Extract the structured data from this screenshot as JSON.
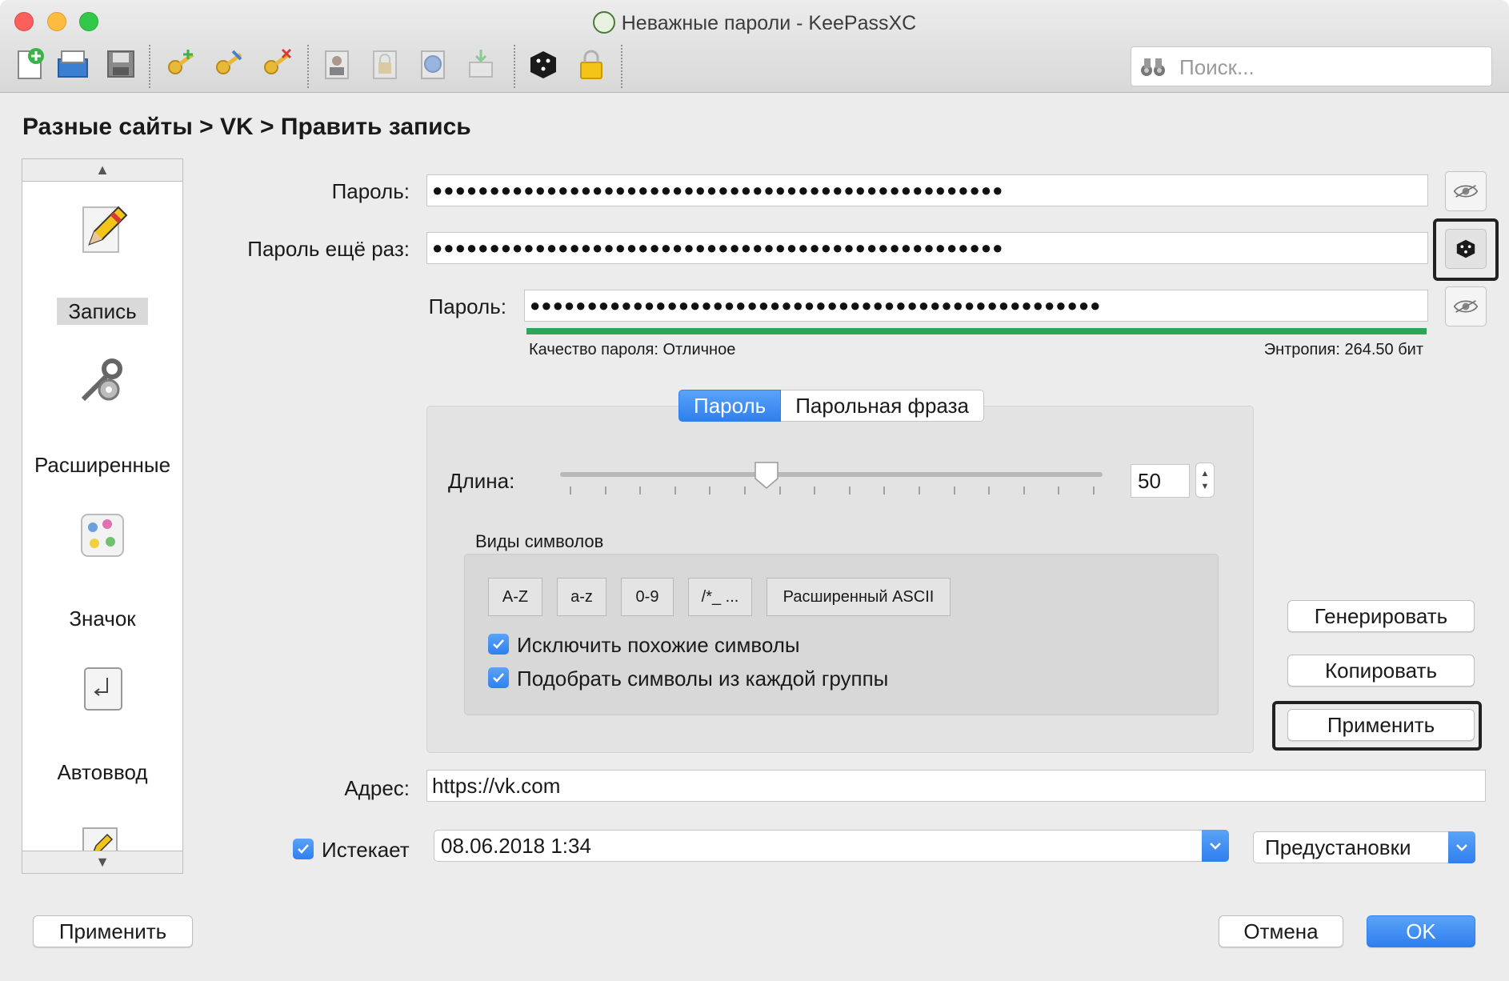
{
  "window": {
    "title": "Неважные пароли - KeePassXC"
  },
  "toolbar": {
    "items": [
      "new-database-icon",
      "open-database-icon",
      "save-database-icon",
      "add-entry-icon",
      "edit-entry-icon",
      "delete-entry-icon",
      "copy-username-icon",
      "copy-password-icon",
      "open-url-icon",
      "autotype-icon",
      "password-generator-icon",
      "lock-database-icon"
    ]
  },
  "search": {
    "placeholder": "Поиск..."
  },
  "breadcrumb": "Разные сайты > VK > Править запись",
  "sidebar": {
    "items": [
      {
        "label": "Запись",
        "icon": "pencil-icon",
        "selected": true
      },
      {
        "label": "Расширенные",
        "icon": "tools-icon",
        "selected": false
      },
      {
        "label": "Значок",
        "icon": "palette-icon",
        "selected": false
      },
      {
        "label": "Автоввод",
        "icon": "return-key-icon",
        "selected": false
      }
    ]
  },
  "form": {
    "password_label": "Пароль:",
    "password_value": "●●●●●●●●●●●●●●●●●●●●●●●●●●●●●●●●●●●●●●●●●●●●●●●●●●",
    "repeat_label": "Пароль ещё раз:",
    "repeat_value": "●●●●●●●●●●●●●●●●●●●●●●●●●●●●●●●●●●●●●●●●●●●●●●●●●●",
    "generated_label": "Пароль:",
    "generated_value": "●●●●●●●●●●●●●●●●●●●●●●●●●●●●●●●●●●●●●●●●●●●●●●●●●●",
    "quality_text": "Качество пароля: Отличное",
    "entropy_text": "Энтропия: 264.50 бит",
    "quality_level": 1.0,
    "quality_color": "#2ea55a",
    "url_label": "Адрес:",
    "url_value": "https://vk.com",
    "expires_label": "Истекает",
    "expires_checked": true,
    "expires_value": "08.06.2018 1:34",
    "presets_label": "Предустановки"
  },
  "generator": {
    "tabs": [
      "Пароль",
      "Парольная фраза"
    ],
    "active_tab": "Пароль",
    "length_label": "Длина:",
    "length_value": "50",
    "slider_level": 0.38,
    "char_group_title": "Виды символов",
    "char_buttons": [
      "A-Z",
      "a-z",
      "0-9",
      "/*_ ...",
      "Расширенный ASCII"
    ],
    "exclude_similar": "Исключить похожие символы",
    "pick_every_group": "Подобрать символы из каждой группы",
    "generate_button": "Генерировать",
    "copy_button": "Копировать",
    "apply_button": "Применить"
  },
  "footer": {
    "apply": "Применить",
    "cancel": "Отмена",
    "ok": "OK"
  },
  "colors": {
    "accent": "#2f7fef",
    "quality_good": "#2ea55a"
  }
}
